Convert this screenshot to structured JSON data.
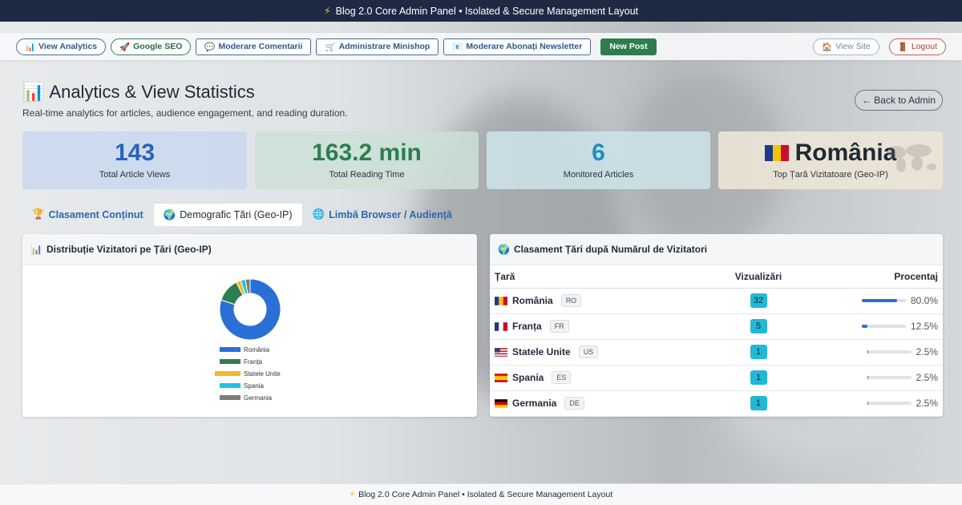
{
  "topbar": {
    "icon": "lightning-icon",
    "title": "Blog 2.0 Core Admin Panel • Isolated & Secure Management Layout"
  },
  "nav": {
    "view_analytics": "View Analytics",
    "google_seo": "Google SEO",
    "moderare_comentarii": "Moderare Comentarii",
    "administrare_minishop": "Administrare Minishop",
    "moderare_abonati": "Moderare Abonați Newsletter",
    "new_post": "New Post",
    "view_site": "View Site",
    "logout": "Logout"
  },
  "page": {
    "title": "Analytics & View Statistics",
    "subtitle": "Real-time analytics for articles, audience engagement, and reading duration.",
    "back": "← Back to Admin"
  },
  "stats": [
    {
      "value": "143",
      "label": "Total Article Views",
      "color": "#2a63b8",
      "bg": "#c9d8ee"
    },
    {
      "value": "163.2 min",
      "label": "Total Reading Time",
      "color": "#2e7d52",
      "bg": "#cde0d6"
    },
    {
      "value": "6",
      "label": "Monitored Articles",
      "color": "#1d8fb8",
      "bg": "#cde5ea"
    },
    {
      "value": "România",
      "label": "Top Țară Vizitatoare (Geo-IP)",
      "color": "#1f2933",
      "bg": "#ece6d6"
    }
  ],
  "tabs": {
    "content": "Clasament Conținut",
    "countries": "Demografic Țări (Geo-IP)",
    "language": "Limbă Browser / Audiență"
  },
  "chart_panel": {
    "title": "Distribuție Vizitatori pe Țări (Geo-IP)"
  },
  "chart_data": {
    "type": "pie",
    "categories": [
      "România",
      "Franța",
      "Statele Unite",
      "Spania",
      "Germania"
    ],
    "values": [
      32,
      5,
      1,
      1,
      1
    ],
    "colors": [
      "#2a6fd6",
      "#2e7d52",
      "#f5b82e",
      "#22c3e0",
      "#7d7d7d"
    ],
    "legend": "bottom"
  },
  "table_panel": {
    "title": "Clasament Țări după Numărul de Vizitatori",
    "headers": {
      "country": "Țară",
      "views": "Vizualizări",
      "percent": "Procentaj"
    },
    "rows": [
      {
        "country": "România",
        "code": "RO",
        "views": "32",
        "percent": "80.0%",
        "fraction": 0.8
      },
      {
        "country": "Franța",
        "code": "FR",
        "views": "5",
        "percent": "12.5%",
        "fraction": 0.125
      },
      {
        "country": "Statele Unite",
        "code": "US",
        "views": "1",
        "percent": "2.5%",
        "fraction": 0.025
      },
      {
        "country": "Spania",
        "code": "ES",
        "views": "1",
        "percent": "2.5%",
        "fraction": 0.025
      },
      {
        "country": "Germania",
        "code": "DE",
        "views": "1",
        "percent": "2.5%",
        "fraction": 0.025
      }
    ]
  },
  "footer": {
    "icon": "lightning-icon",
    "text": "Blog 2.0 Core Admin Panel • Isolated & Secure Management Layout"
  }
}
